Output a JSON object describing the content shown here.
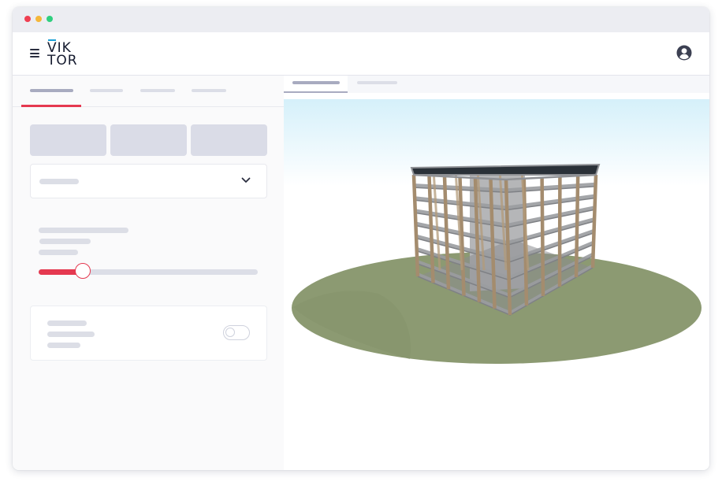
{
  "app": {
    "logo_line1": "VIK",
    "logo_line2": "TOR"
  },
  "colors": {
    "accent": "#e53950",
    "logo_bar": "#1aa0d6",
    "skeleton": "#dcdee7",
    "sky": "#d5f0fa",
    "ground": "#8c9a72",
    "column": "#a48c6e",
    "slab": "#9a9ca0",
    "core": "#b5b6b8"
  },
  "icons": {
    "menu": "hamburger-icon",
    "user": "user-circle-icon",
    "dropdown": "chevron-down-icon"
  },
  "controls": {
    "slider_value_fraction": 0.2,
    "toggle_on": false
  },
  "viewer": {
    "active_tab_index": 0
  }
}
